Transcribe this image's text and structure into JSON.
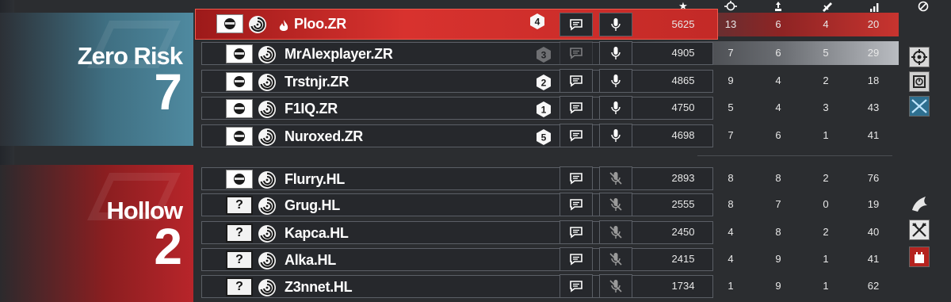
{
  "stat_headers": [
    {
      "icon": "score-star-icon",
      "glyph": "★"
    },
    {
      "icon": "kills-crosshair-icon"
    },
    {
      "icon": "assists-icon"
    },
    {
      "icon": "deaths-icon"
    },
    {
      "icon": "ping-icon"
    },
    {
      "icon": "mute-icon"
    }
  ],
  "teams": [
    {
      "name": "Zero Risk",
      "score": "7",
      "color": "#4f8aa0",
      "players": [
        {
          "name": "Ploo.ZR",
          "rank": "4",
          "score": "5625",
          "kills": "13",
          "assists": "6",
          "deaths": "4",
          "ping": "20",
          "local": true
        },
        {
          "name": "MrAlexplayer.ZR",
          "rank": "3",
          "score": "4905",
          "kills": "7",
          "assists": "6",
          "deaths": "5",
          "ping": "29",
          "dim": true
        },
        {
          "name": "Trstnjr.ZR",
          "rank": "2",
          "score": "4865",
          "kills": "9",
          "assists": "4",
          "deaths": "2",
          "ping": "18"
        },
        {
          "name": "F1IQ.ZR",
          "rank": "1",
          "score": "4750",
          "kills": "5",
          "assists": "4",
          "deaths": "3",
          "ping": "43"
        },
        {
          "name": "Nuroxed.ZR",
          "rank": "5",
          "score": "4698",
          "kills": "7",
          "assists": "6",
          "deaths": "1",
          "ping": "41"
        }
      ]
    },
    {
      "name": "Hollow",
      "score": "2",
      "color": "#b8252a",
      "players": [
        {
          "name": "Flurry.HL",
          "score": "2893",
          "kills": "8",
          "assists": "8",
          "deaths": "2",
          "ping": "76"
        },
        {
          "name": "Grug.HL",
          "score": "2555",
          "kills": "8",
          "assists": "7",
          "deaths": "0",
          "ping": "19",
          "unknown": "?"
        },
        {
          "name": "Kapca.HL",
          "score": "2450",
          "kills": "4",
          "assists": "8",
          "deaths": "2",
          "ping": "40",
          "unknown": "?"
        },
        {
          "name": "Alka.HL",
          "score": "2415",
          "kills": "4",
          "assists": "9",
          "deaths": "1",
          "ping": "41",
          "unknown": "?"
        },
        {
          "name": "Z3nnet.HL",
          "score": "1734",
          "kills": "1",
          "assists": "9",
          "deaths": "1",
          "ping": "62",
          "unknown": "?"
        }
      ]
    }
  ],
  "side_icons": [
    "kill-target-icon",
    "defuser-icon",
    "swords-icon",
    "dragon-icon",
    "crossed-axes-icon",
    "tower-icon"
  ]
}
